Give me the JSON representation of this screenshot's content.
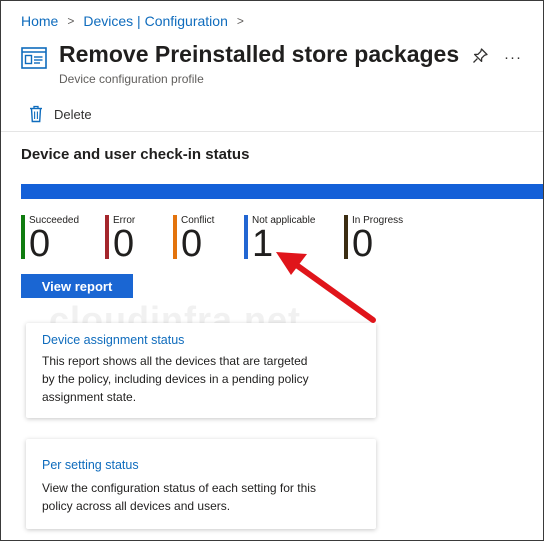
{
  "breadcrumb": {
    "items": [
      "Home",
      "Devices | Configuration"
    ],
    "separator": ">"
  },
  "header": {
    "icon": "policy-document-icon",
    "title": "Remove Preinstalled store packages",
    "subtitle": "Device configuration profile",
    "pin_icon": "pin-icon",
    "more_label": "···"
  },
  "toolbar": {
    "delete_icon": "trash-icon",
    "delete_label": "Delete"
  },
  "checkin": {
    "title": "Device and user check-in status",
    "bar_color": "#1460d8",
    "tiles": [
      {
        "label": "Succeeded",
        "value": "0",
        "color": "#107c10"
      },
      {
        "label": "Error",
        "value": "0",
        "color": "#a4262c"
      },
      {
        "label": "Conflict",
        "value": "0",
        "color": "#e3730d"
      },
      {
        "label": "Not applicable",
        "value": "1",
        "color": "#2266d2"
      },
      {
        "label": "In Progress",
        "value": "0",
        "color": "#3b2d12"
      }
    ],
    "view_report_label": "View report"
  },
  "watermark": "cloudinfra.net",
  "cards": [
    {
      "title": "Device assignment status",
      "description": "This report shows all the devices that are targeted by the policy, including devices in a pending policy assignment state."
    },
    {
      "title": "Per setting status",
      "description": "View the configuration status of each setting for this policy across all devices and users."
    }
  ],
  "annotation": {
    "icon": "red-arrow-icon",
    "color": "#e0151b"
  }
}
